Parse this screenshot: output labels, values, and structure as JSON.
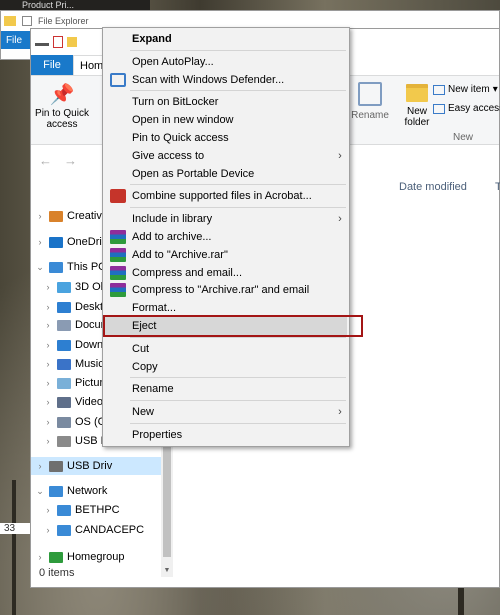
{
  "taskbar_title": "Product Pri...",
  "back_window": {
    "title": "File Explorer",
    "file_tab": "File"
  },
  "explorer": {
    "tabs": {
      "file": "File",
      "home": "Hom"
    },
    "ribbon": {
      "pin_label": "Pin to Quick access",
      "rename_label": "Rename",
      "new_folder_label": "New folder",
      "new_item_label": "New item",
      "easy_access_label": "Easy access",
      "new_group_label": "New"
    },
    "column_headers": {
      "date_modified": "Date modified",
      "type_cut": "T"
    },
    "status_text": "0 items",
    "left_count": "33",
    "sidebar": [
      {
        "label": "Creative",
        "icon": "creative-cloud-icon",
        "color": "#d9822b",
        "level": 0,
        "chevron": "›"
      },
      {
        "label": "OneDriv",
        "icon": "onedrive-icon",
        "color": "#1a73c8",
        "level": 0,
        "chevron": "›"
      },
      {
        "label": "This PC",
        "icon": "pc-icon",
        "color": "#3a8ad6",
        "level": 0,
        "chevron": "⌄"
      },
      {
        "label": "3D Obj",
        "icon": "3d-objects-icon",
        "color": "#4aa3df",
        "level": 1,
        "chevron": "›"
      },
      {
        "label": "Deskto",
        "icon": "desktop-icon",
        "color": "#2d7fd1",
        "level": 1,
        "chevron": "›"
      },
      {
        "label": "Docum",
        "icon": "documents-icon",
        "color": "#8a9bb3",
        "level": 1,
        "chevron": "›"
      },
      {
        "label": "Down",
        "icon": "downloads-icon",
        "color": "#2d7fd1",
        "level": 1,
        "chevron": "›"
      },
      {
        "label": "Music",
        "icon": "music-icon",
        "color": "#3a73c8",
        "level": 1,
        "chevron": "›"
      },
      {
        "label": "Picture",
        "icon": "pictures-icon",
        "color": "#7ab0d8",
        "level": 1,
        "chevron": "›"
      },
      {
        "label": "Videos",
        "icon": "videos-icon",
        "color": "#5f6f8a",
        "level": 1,
        "chevron": "›"
      },
      {
        "label": "OS (C:)",
        "icon": "os-drive-icon",
        "color": "#7a8aa0",
        "level": 1,
        "chevron": "›"
      },
      {
        "label": "USB Dri",
        "icon": "usb-drive-icon",
        "color": "#8a8a8a",
        "level": 1,
        "chevron": "›"
      },
      {
        "label": "USB Driv",
        "icon": "usb-drive-icon",
        "color": "#6f6f6f",
        "level": 0,
        "chevron": "›",
        "selected": true
      },
      {
        "label": "Network",
        "icon": "network-icon",
        "color": "#3a8ad6",
        "level": 0,
        "chevron": "⌄"
      },
      {
        "label": "BETHPC",
        "icon": "computer-icon",
        "color": "#3a8ad6",
        "level": 1,
        "chevron": "›"
      },
      {
        "label": "CANDACEPC",
        "icon": "computer-icon",
        "color": "#3a8ad6",
        "level": 1,
        "chevron": "›"
      },
      {
        "label": "Homegroup",
        "icon": "homegroup-icon",
        "color": "#2e9b3c",
        "level": 0,
        "chevron": "›"
      }
    ]
  },
  "context_menu": [
    {
      "label": "Expand",
      "bold": true
    },
    {
      "separator": true
    },
    {
      "label": "Open AutoPlay..."
    },
    {
      "label": "Scan with Windows Defender...",
      "icon": "shield-icon"
    },
    {
      "separator": true
    },
    {
      "label": "Turn on BitLocker"
    },
    {
      "label": "Open in new window"
    },
    {
      "label": "Pin to Quick access"
    },
    {
      "label": "Give access to",
      "submenu": true
    },
    {
      "label": "Open as Portable Device"
    },
    {
      "separator": true
    },
    {
      "label": "Combine supported files in Acrobat...",
      "icon": "acrobat-icon"
    },
    {
      "separator": true
    },
    {
      "label": "Include in library",
      "submenu": true
    },
    {
      "label": "Add to archive...",
      "icon": "rar-icon"
    },
    {
      "label": "Add to \"Archive.rar\"",
      "icon": "rar-icon"
    },
    {
      "label": "Compress and email...",
      "icon": "rar-icon"
    },
    {
      "label": "Compress to \"Archive.rar\" and email",
      "icon": "rar-icon"
    },
    {
      "label": "Format..."
    },
    {
      "label": "Eject",
      "highlighted": true
    },
    {
      "separator": true
    },
    {
      "label": "Cut"
    },
    {
      "label": "Copy"
    },
    {
      "separator": true
    },
    {
      "label": "Rename"
    },
    {
      "separator": true
    },
    {
      "label": "New",
      "submenu": true
    },
    {
      "separator": true
    },
    {
      "label": "Properties"
    }
  ],
  "colors": {
    "accent": "#1979ca",
    "highlight_box": "#a31515",
    "selection": "#cce8ff"
  }
}
